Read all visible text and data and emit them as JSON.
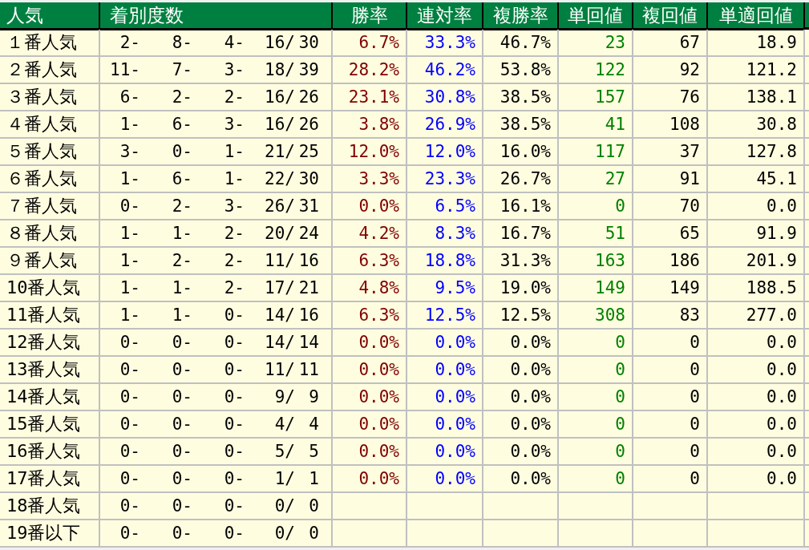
{
  "columns": [
    {
      "label": "人気"
    },
    {
      "label": "着別度数"
    },
    {
      "label": "勝率",
      "color": "#800000"
    },
    {
      "label": "連対率",
      "color": "#0000ff"
    },
    {
      "label": "複勝率",
      "color": "#000000"
    },
    {
      "label": "単回値",
      "color": "#008000"
    },
    {
      "label": "複回値",
      "color": "#000000"
    },
    {
      "label": "単適回値",
      "color": "#000000"
    }
  ],
  "rows": [
    {
      "label": "１番人気",
      "record": [
        "2-",
        "8-",
        "4-",
        "16/",
        "30"
      ],
      "values": [
        "6.7%",
        "33.3%",
        "46.7%",
        "23",
        "67",
        "18.9"
      ]
    },
    {
      "label": "２番人気",
      "record": [
        "11-",
        "7-",
        "3-",
        "18/",
        "39"
      ],
      "values": [
        "28.2%",
        "46.2%",
        "53.8%",
        "122",
        "92",
        "121.2"
      ]
    },
    {
      "label": "３番人気",
      "record": [
        "6-",
        "2-",
        "2-",
        "16/",
        "26"
      ],
      "values": [
        "23.1%",
        "30.8%",
        "38.5%",
        "157",
        "76",
        "138.1"
      ]
    },
    {
      "label": "４番人気",
      "record": [
        "1-",
        "6-",
        "3-",
        "16/",
        "26"
      ],
      "values": [
        "3.8%",
        "26.9%",
        "38.5%",
        "41",
        "108",
        "30.8"
      ]
    },
    {
      "label": "５番人気",
      "record": [
        "3-",
        "0-",
        "1-",
        "21/",
        "25"
      ],
      "values": [
        "12.0%",
        "12.0%",
        "16.0%",
        "117",
        "37",
        "127.8"
      ]
    },
    {
      "label": "６番人気",
      "record": [
        "1-",
        "6-",
        "1-",
        "22/",
        "30"
      ],
      "values": [
        "3.3%",
        "23.3%",
        "26.7%",
        "27",
        "91",
        "45.1"
      ]
    },
    {
      "label": "７番人気",
      "record": [
        "0-",
        "2-",
        "3-",
        "26/",
        "31"
      ],
      "values": [
        "0.0%",
        "6.5%",
        "16.1%",
        "0",
        "70",
        "0.0"
      ]
    },
    {
      "label": "８番人気",
      "record": [
        "1-",
        "1-",
        "2-",
        "20/",
        "24"
      ],
      "values": [
        "4.2%",
        "8.3%",
        "16.7%",
        "51",
        "65",
        "91.9"
      ]
    },
    {
      "label": "９番人気",
      "record": [
        "1-",
        "2-",
        "2-",
        "11/",
        "16"
      ],
      "values": [
        "6.3%",
        "18.8%",
        "31.3%",
        "163",
        "186",
        "201.9"
      ]
    },
    {
      "label": "10番人気",
      "record": [
        "1-",
        "1-",
        "2-",
        "17/",
        "21"
      ],
      "values": [
        "4.8%",
        "9.5%",
        "19.0%",
        "149",
        "149",
        "188.5"
      ]
    },
    {
      "label": "11番人気",
      "record": [
        "1-",
        "1-",
        "0-",
        "14/",
        "16"
      ],
      "values": [
        "6.3%",
        "12.5%",
        "12.5%",
        "308",
        "83",
        "277.0"
      ]
    },
    {
      "label": "12番人気",
      "record": [
        "0-",
        "0-",
        "0-",
        "14/",
        "14"
      ],
      "values": [
        "0.0%",
        "0.0%",
        "0.0%",
        "0",
        "0",
        "0.0"
      ]
    },
    {
      "label": "13番人気",
      "record": [
        "0-",
        "0-",
        "0-",
        "11/",
        "11"
      ],
      "values": [
        "0.0%",
        "0.0%",
        "0.0%",
        "0",
        "0",
        "0.0"
      ]
    },
    {
      "label": "14番人気",
      "record": [
        "0-",
        "0-",
        "0-",
        "9/",
        "9"
      ],
      "values": [
        "0.0%",
        "0.0%",
        "0.0%",
        "0",
        "0",
        "0.0"
      ]
    },
    {
      "label": "15番人気",
      "record": [
        "0-",
        "0-",
        "0-",
        "4/",
        "4"
      ],
      "values": [
        "0.0%",
        "0.0%",
        "0.0%",
        "0",
        "0",
        "0.0"
      ]
    },
    {
      "label": "16番人気",
      "record": [
        "0-",
        "0-",
        "0-",
        "5/",
        "5"
      ],
      "values": [
        "0.0%",
        "0.0%",
        "0.0%",
        "0",
        "0",
        "0.0"
      ]
    },
    {
      "label": "17番人気",
      "record": [
        "0-",
        "0-",
        "0-",
        "1/",
        "1"
      ],
      "values": [
        "0.0%",
        "0.0%",
        "0.0%",
        "0",
        "0",
        "0.0"
      ]
    },
    {
      "label": "18番人気",
      "record": [
        "0-",
        "0-",
        "0-",
        "0/",
        "0"
      ],
      "values": []
    },
    {
      "label": "19番以下",
      "record": [
        "0-",
        "0-",
        "0-",
        "0/",
        "0"
      ],
      "values": []
    }
  ]
}
